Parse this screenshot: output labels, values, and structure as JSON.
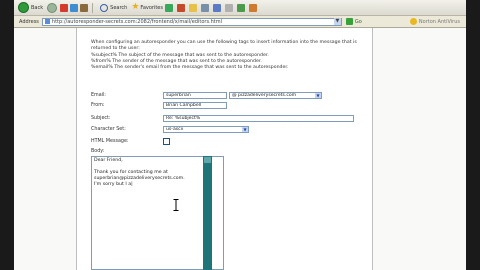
{
  "browser": {
    "toolbar": {
      "back_label": "Back",
      "search_label": "Search",
      "favorites_label": "Favorites"
    },
    "address": {
      "label": "Address",
      "url": "http://autoresponder-secrets.com:2082/frontend/x/mail/editors.html",
      "go_label": "Go",
      "right_label": "Norton AntiVirus"
    }
  },
  "page": {
    "intro_lines": [
      "When configuring an autoresponder you can use the following tags to insert information into the message that is",
      "returned to the user:",
      "%subject%  The subject of the message that was sent to the autoresponder.",
      "%from%  The sender of the message that was sent to the autoresponder.",
      "%email%  The sender's email from the message that was sent to the autoresponder."
    ],
    "form": {
      "email_label": "Email:",
      "email_value": "superbrian",
      "domain_value": "@ pizzadeliverysecrets.com",
      "from_label": "From:",
      "from_value": "Brian Campbell",
      "subject_label": "Subject:",
      "subject_value": "Re: %subject%",
      "charset_label": "Character Set:",
      "charset_value": "us-ascii",
      "html_label": "HTML Message:",
      "body_label": "Body:",
      "body_lines": [
        "Dear Friend,",
        "",
        "Thank you for contacting me at",
        "superbrian@pizzadeliverysecrets.com.",
        "I'm sorry but I a|"
      ]
    }
  }
}
